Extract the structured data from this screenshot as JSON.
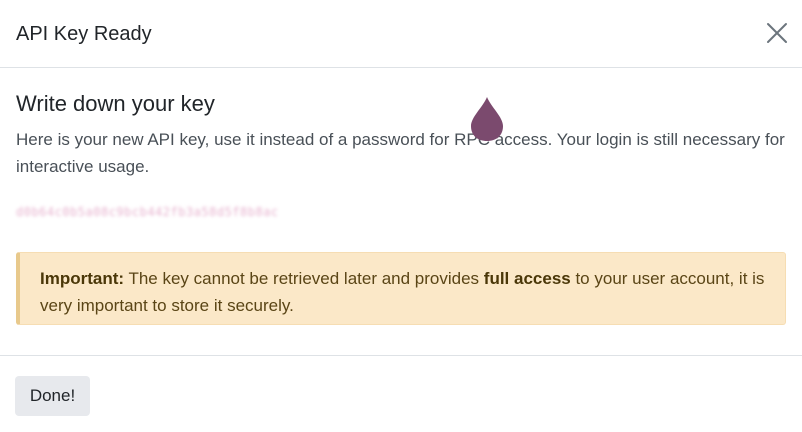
{
  "dialog": {
    "title": "API Key Ready",
    "close_icon": "close-icon"
  },
  "body": {
    "heading": "Write down your key",
    "description": "Here is your new API key, use it instead of a password for RPC access. Your login is still necessary for interactive usage.",
    "api_key": "d0b64c0b5a08c9bcb442fb3a58d5f8b8ac"
  },
  "alert": {
    "label": "Important:",
    "text_before": " The key cannot be retrieved later and provides ",
    "emphasis": "full access",
    "text_after": " to your user account, it is very important to store it securely."
  },
  "footer": {
    "done_label": "Done!"
  },
  "colors": {
    "alert_bg": "#fbe8c8",
    "cursor": "#7b4a6e"
  }
}
